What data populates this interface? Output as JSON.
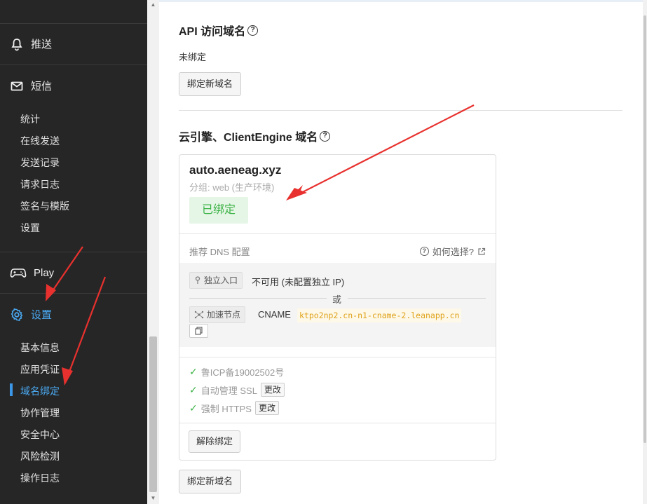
{
  "sidebar": {
    "groups": [
      {
        "label": "推送",
        "icon": "bell-icon"
      },
      {
        "label": "短信",
        "icon": "mail-icon"
      },
      {
        "label": "Play",
        "icon": "gamepad-icon"
      },
      {
        "label": "设置",
        "icon": "gear-icon"
      }
    ],
    "sms_items": [
      "统计",
      "在线发送",
      "发送记录",
      "请求日志",
      "签名与模版",
      "设置"
    ],
    "settings_items": [
      "基本信息",
      "应用凭证",
      "域名绑定",
      "协作管理",
      "安全中心",
      "风险检测",
      "操作日志"
    ],
    "active_item": "域名绑定",
    "active_color": "#4aa8f0"
  },
  "api_section": {
    "title": "API 访问域名",
    "status": "未绑定",
    "bind_button": "绑定新域名"
  },
  "engine_section": {
    "title": "云引擎、ClientEngine 域名",
    "card": {
      "domain": "auto.aeneag.xyz",
      "group": "分组: web (生产环境)",
      "badge": "已绑定",
      "dns_title": "推荐 DNS 配置",
      "how_choose": "如何选择?",
      "dedicated_tag": "独立入口",
      "dedicated_value": "不可用 (未配置独立 IP)",
      "or": "或",
      "accel_tag": "加速节点",
      "cname_label": "CNAME",
      "cname_value": "ktpo2np2.cn-n1-cname-2.leanapp.cn",
      "checks": [
        {
          "label": "鲁ICP备19002502号",
          "button": ""
        },
        {
          "label": "自动管理 SSL",
          "button": "更改"
        },
        {
          "label": "强制 HTTPS",
          "button": "更改"
        }
      ],
      "unbind_button": "解除绑定"
    },
    "bind_button": "绑定新域名"
  },
  "colors": {
    "sidebar_bg": "#262626",
    "success_green": "#3bb346",
    "annotation_red": "#e8312e"
  }
}
